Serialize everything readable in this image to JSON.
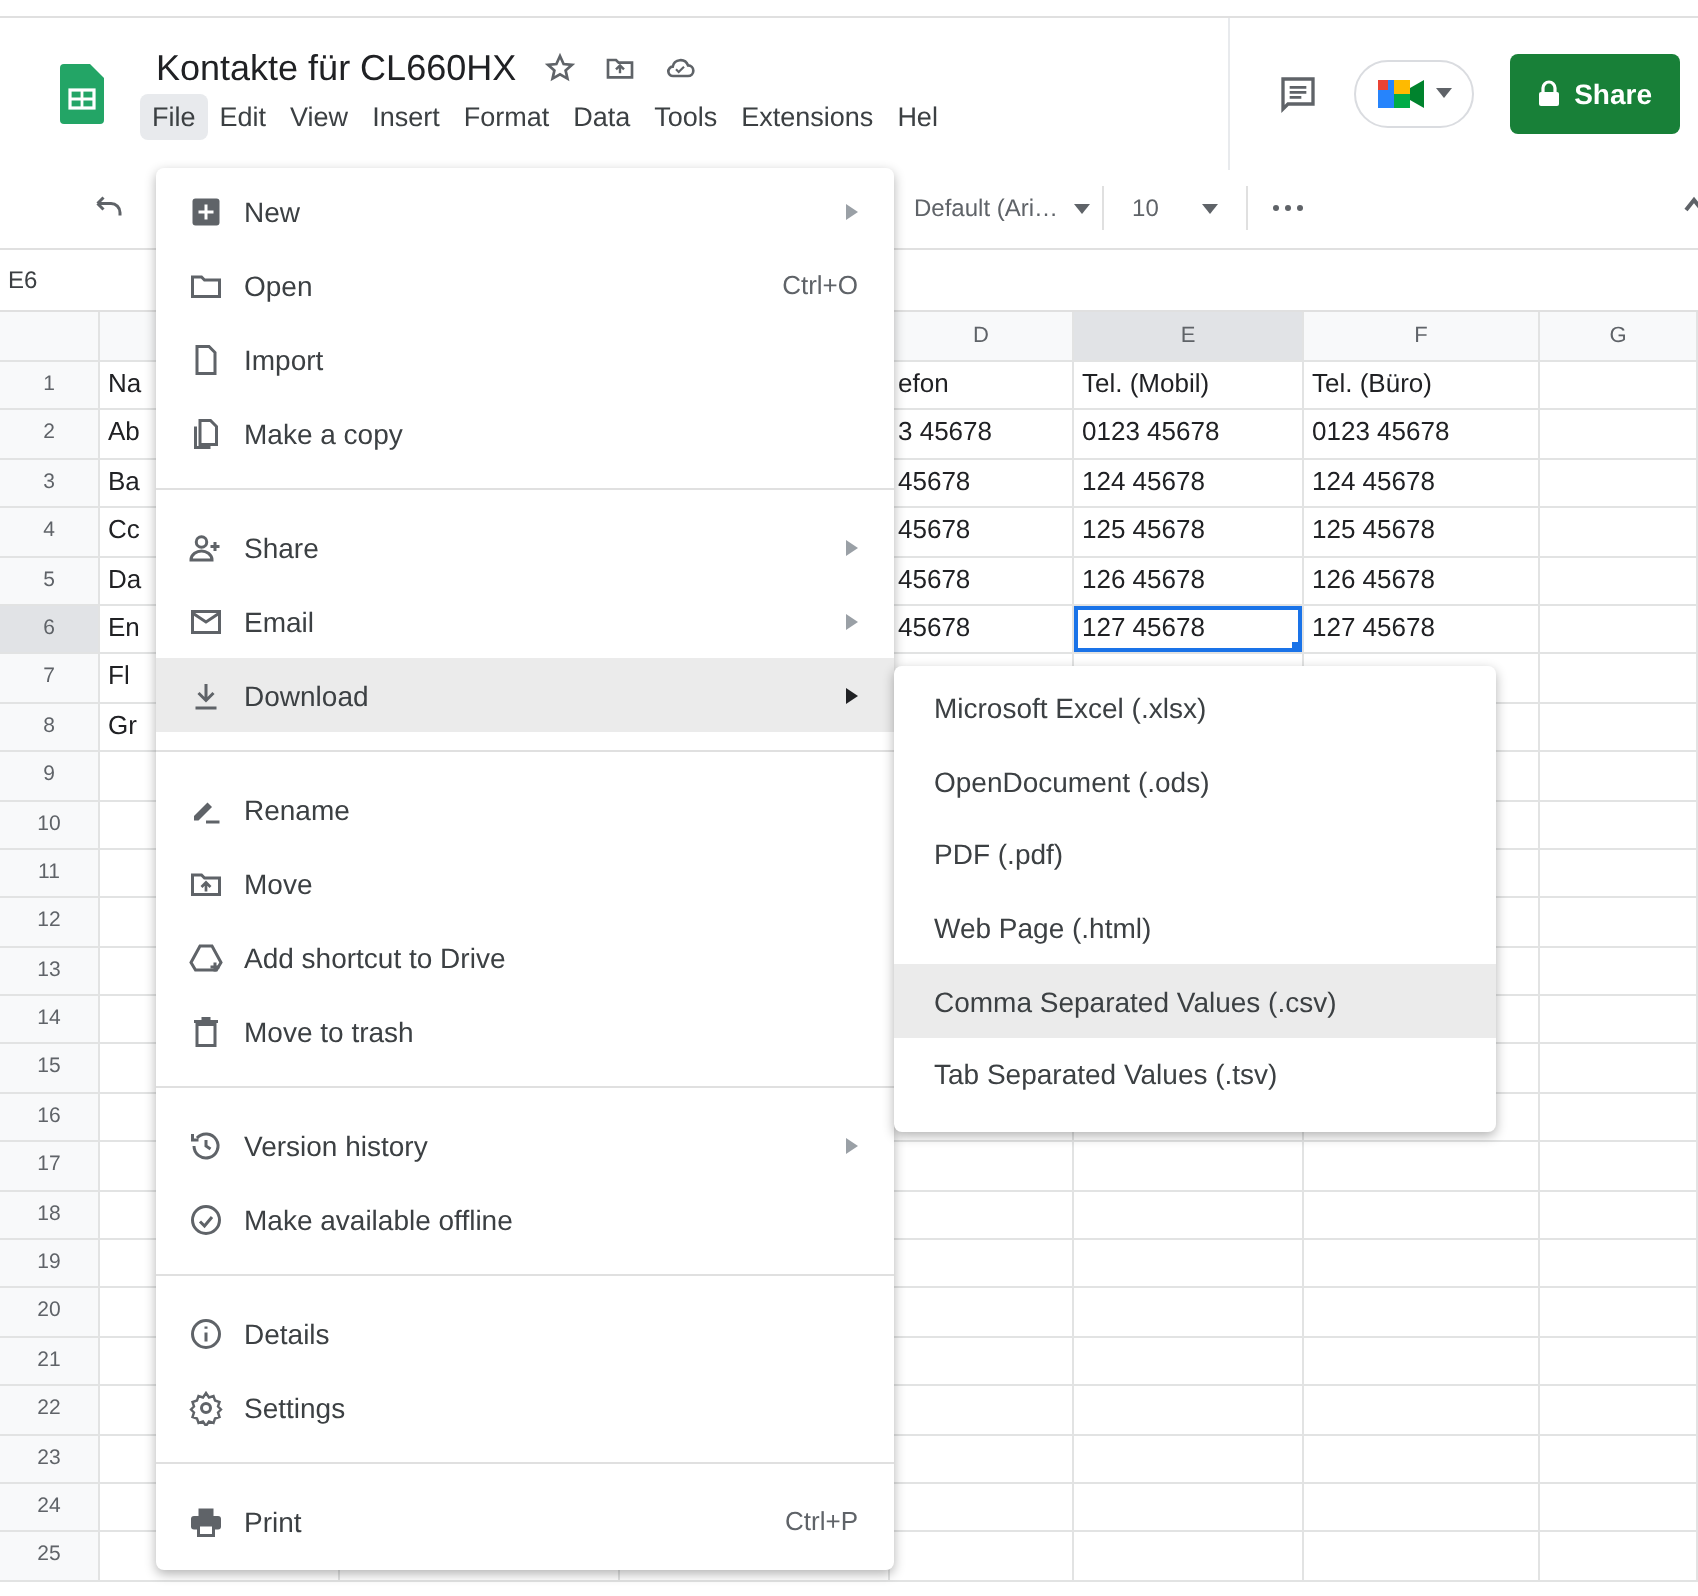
{
  "document": {
    "title": "Kontakte für CL660HX"
  },
  "menu_bar": [
    {
      "label": "File",
      "selected": true
    },
    {
      "label": "Edit",
      "selected": false
    },
    {
      "label": "View",
      "selected": false
    },
    {
      "label": "Insert",
      "selected": false
    },
    {
      "label": "Format",
      "selected": false
    },
    {
      "label": "Data",
      "selected": false
    },
    {
      "label": "Tools",
      "selected": false
    },
    {
      "label": "Extensions",
      "selected": false
    },
    {
      "label": "Hel",
      "selected": false
    }
  ],
  "share_button": "Share",
  "toolbar": {
    "font": "Default (Ari…",
    "font_size": "10"
  },
  "name_box": "E6",
  "grid": {
    "column_headers": [
      {
        "label": "D",
        "selected": false
      },
      {
        "label": "E",
        "selected": true
      },
      {
        "label": "F",
        "selected": false
      },
      {
        "label": "G",
        "selected": false
      }
    ],
    "rows": [
      {
        "number": "1",
        "selected": false,
        "cells": [
          {
            "text": "Na",
            "selected": false
          },
          {
            "text": "efon",
            "selected": false
          },
          {
            "text": "Tel. (Mobil)",
            "selected": false
          },
          {
            "text": "Tel. (Büro)",
            "selected": false
          }
        ]
      },
      {
        "number": "2",
        "selected": false,
        "cells": [
          {
            "text": "Ab",
            "selected": false
          },
          {
            "text": "3 45678",
            "selected": false
          },
          {
            "text": "0123 45678",
            "selected": false
          },
          {
            "text": "0123 45678",
            "selected": false
          }
        ]
      },
      {
        "number": "3",
        "selected": false,
        "cells": [
          {
            "text": "Ba",
            "selected": false
          },
          {
            "text": "45678",
            "selected": false
          },
          {
            "text": "124 45678",
            "selected": false
          },
          {
            "text": "124 45678",
            "selected": false
          }
        ]
      },
      {
        "number": "4",
        "selected": false,
        "cells": [
          {
            "text": "Cc",
            "selected": false
          },
          {
            "text": "45678",
            "selected": false
          },
          {
            "text": "125 45678",
            "selected": false
          },
          {
            "text": "125 45678",
            "selected": false
          }
        ]
      },
      {
        "number": "5",
        "selected": false,
        "cells": [
          {
            "text": "Da",
            "selected": false
          },
          {
            "text": "45678",
            "selected": false
          },
          {
            "text": "126 45678",
            "selected": false
          },
          {
            "text": "126 45678",
            "selected": false
          }
        ]
      },
      {
        "number": "6",
        "selected": true,
        "cells": [
          {
            "text": "En",
            "selected": false
          },
          {
            "text": "45678",
            "selected": false
          },
          {
            "text": "127 45678",
            "selected": true
          },
          {
            "text": "127 45678",
            "selected": false
          }
        ]
      },
      {
        "number": "7",
        "selected": false,
        "cells": [
          {
            "text": "Fl",
            "selected": false
          }
        ]
      },
      {
        "number": "8",
        "selected": false,
        "cells": [
          {
            "text": "Gr",
            "selected": false
          }
        ]
      },
      {
        "number": "9",
        "selected": false
      },
      {
        "number": "10",
        "selected": false
      },
      {
        "number": "11",
        "selected": false
      },
      {
        "number": "12",
        "selected": false
      },
      {
        "number": "13",
        "selected": false
      },
      {
        "number": "14",
        "selected": false
      },
      {
        "number": "15",
        "selected": false
      },
      {
        "number": "16",
        "selected": false
      },
      {
        "number": "17",
        "selected": false
      },
      {
        "number": "18",
        "selected": false
      },
      {
        "number": "19",
        "selected": false
      },
      {
        "number": "20",
        "selected": false
      },
      {
        "number": "21",
        "selected": false
      },
      {
        "number": "22",
        "selected": false
      },
      {
        "number": "23",
        "selected": false
      },
      {
        "number": "24",
        "selected": false
      },
      {
        "number": "25",
        "selected": false
      }
    ]
  },
  "file_menu": [
    {
      "kind": "item",
      "label": "New",
      "has_submenu": true,
      "selected": false
    },
    {
      "kind": "item",
      "label": "Open",
      "shortcut": "Ctrl+O",
      "selected": false
    },
    {
      "kind": "item",
      "label": "Import",
      "selected": false
    },
    {
      "kind": "item",
      "label": "Make a copy",
      "selected": false
    },
    {
      "kind": "separator"
    },
    {
      "kind": "item",
      "label": "Share",
      "has_submenu": true,
      "selected": false
    },
    {
      "kind": "item",
      "label": "Email",
      "has_submenu": true,
      "selected": false
    },
    {
      "kind": "item",
      "label": "Download",
      "has_submenu": true,
      "selected": true
    },
    {
      "kind": "separator"
    },
    {
      "kind": "item",
      "label": "Rename",
      "selected": false
    },
    {
      "kind": "item",
      "label": "Move",
      "selected": false
    },
    {
      "kind": "item",
      "label": "Add shortcut to Drive",
      "selected": false
    },
    {
      "kind": "item",
      "label": "Move to trash",
      "selected": false
    },
    {
      "kind": "separator"
    },
    {
      "kind": "item",
      "label": "Version history",
      "has_submenu": true,
      "selected": false
    },
    {
      "kind": "item",
      "label": "Make available offline",
      "selected": false
    },
    {
      "kind": "separator"
    },
    {
      "kind": "item",
      "label": "Details",
      "selected": false
    },
    {
      "kind": "item",
      "label": "Settings",
      "selected": false
    },
    {
      "kind": "separator"
    },
    {
      "kind": "item",
      "label": "Print",
      "shortcut": "Ctrl+P",
      "selected": false
    }
  ],
  "download_submenu": [
    {
      "label": "Microsoft Excel (.xlsx)",
      "selected": false
    },
    {
      "label": "OpenDocument (.ods)",
      "selected": false
    },
    {
      "label": "PDF (.pdf)",
      "selected": false
    },
    {
      "label": "Web Page (.html)",
      "selected": false
    },
    {
      "label": "Comma Separated Values (.csv)",
      "selected": true
    },
    {
      "label": "Tab Separated Values (.tsv)",
      "selected": false
    }
  ]
}
